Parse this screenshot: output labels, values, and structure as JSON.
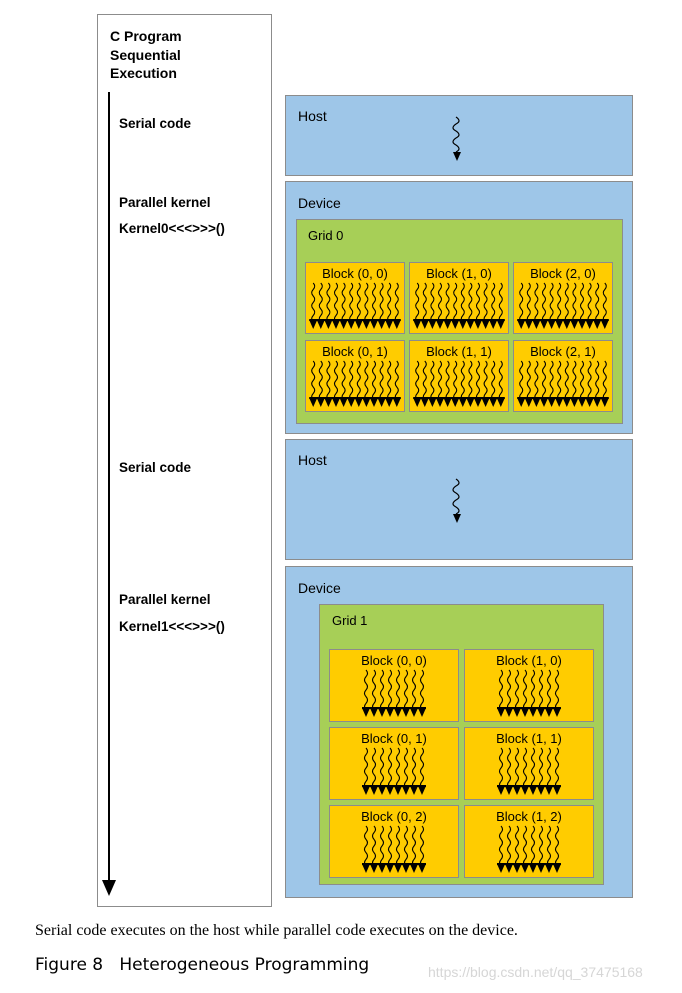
{
  "left_panel": {
    "title_lines": [
      "C Program",
      "Sequential",
      "Execution"
    ],
    "sections": [
      {
        "label": "Serial code"
      },
      {
        "label": "Parallel kernel",
        "kernel": "Kernel0<<<>>>()"
      },
      {
        "label": "Serial code"
      },
      {
        "label": "Parallel kernel",
        "kernel": "Kernel1<<<>>>()"
      }
    ]
  },
  "host_1": {
    "title": "Host"
  },
  "device_1": {
    "title": "Device",
    "grid": {
      "title": "Grid 0",
      "columns": 3,
      "threads_per_block": 12,
      "blocks": [
        "Block (0, 0)",
        "Block (1, 0)",
        "Block (2, 0)",
        "Block (0, 1)",
        "Block (1, 1)",
        "Block (2, 1)"
      ]
    }
  },
  "host_2": {
    "title": "Host"
  },
  "device_2": {
    "title": "Device",
    "grid": {
      "title": "Grid 1",
      "columns": 2,
      "threads_per_block": 8,
      "blocks": [
        "Block (0, 0)",
        "Block (1, 0)",
        "Block (0, 1)",
        "Block (1, 1)",
        "Block (0, 2)",
        "Block (1, 2)"
      ]
    }
  },
  "caption": "Serial code executes on the host while parallel code executes on the device.",
  "figure_label": "Figure 8   Heterogeneous Programming",
  "watermark": "https://blog.csdn.net/qq_37475168",
  "colors": {
    "host_device_bg": "#9ec6e8",
    "grid_bg": "#a7cf57",
    "block_bg": "#ffcc00",
    "border": "#8c8c8c"
  }
}
